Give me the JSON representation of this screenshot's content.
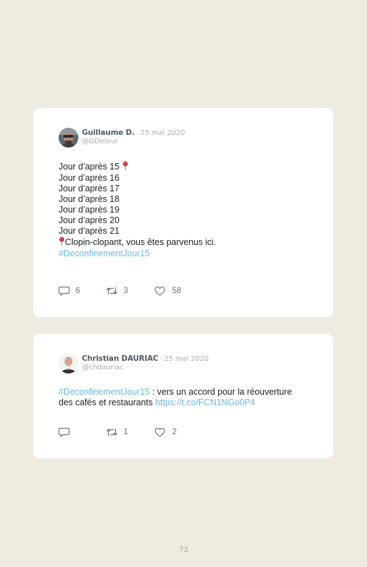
{
  "tweets": [
    {
      "display_name": "Guillaume D.",
      "separator": "·",
      "date": "25 mai 2020",
      "handle": "@GDeleur",
      "lines": [
        "Jour d’après 15",
        "Jour d’après 16",
        "Jour d’après 17",
        "Jour d’après 18",
        "Jour d’après 19",
        "Jour d’après 20",
        "Jour d’après 21"
      ],
      "closing_text": "Clopin-clopant, vous êtes parvenus ici.",
      "hashtag": "#DeconfinementJour15",
      "pin_icon": "round-pushpin-icon",
      "replies": "6",
      "retweets": "3",
      "likes": "58"
    },
    {
      "display_name": "Christian DAURIAC",
      "separator": "·",
      "date": "25 mai 2020",
      "handle": "@chdauriac",
      "hashtag": "#DeconfinementJour15",
      "text_1": " : vers un accord pour la réouverture",
      "text_2": "des cafés et restaurants ",
      "link": "https://t.co/FCN1NGo0P4",
      "replies": "",
      "retweets": "1",
      "likes": "2"
    }
  ],
  "page_number": "73",
  "colors": {
    "background": "#efebe0",
    "card": "#ffffff",
    "link": "#68b8e6",
    "name": "#4d5a69",
    "meta": "#a7abaf"
  }
}
